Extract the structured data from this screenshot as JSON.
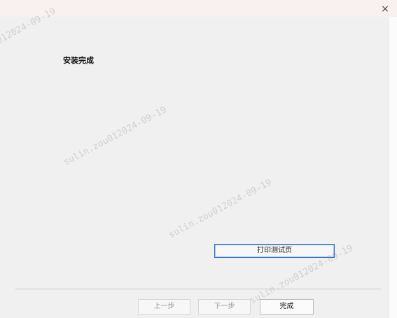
{
  "dialog": {
    "close_glyph": "×",
    "heading": "安装完成",
    "print_test_label": "打印测试页"
  },
  "footer": {
    "back_label": "上一步",
    "next_label": "下一步",
    "finish_label": "完成"
  },
  "watermark": {
    "top_left": "012024-09-19",
    "line_1": "sulin.zou012024-09-19",
    "line_2": "sulin.zou012024-09-19",
    "line_3": "sulin.zou012024-09-19"
  }
}
